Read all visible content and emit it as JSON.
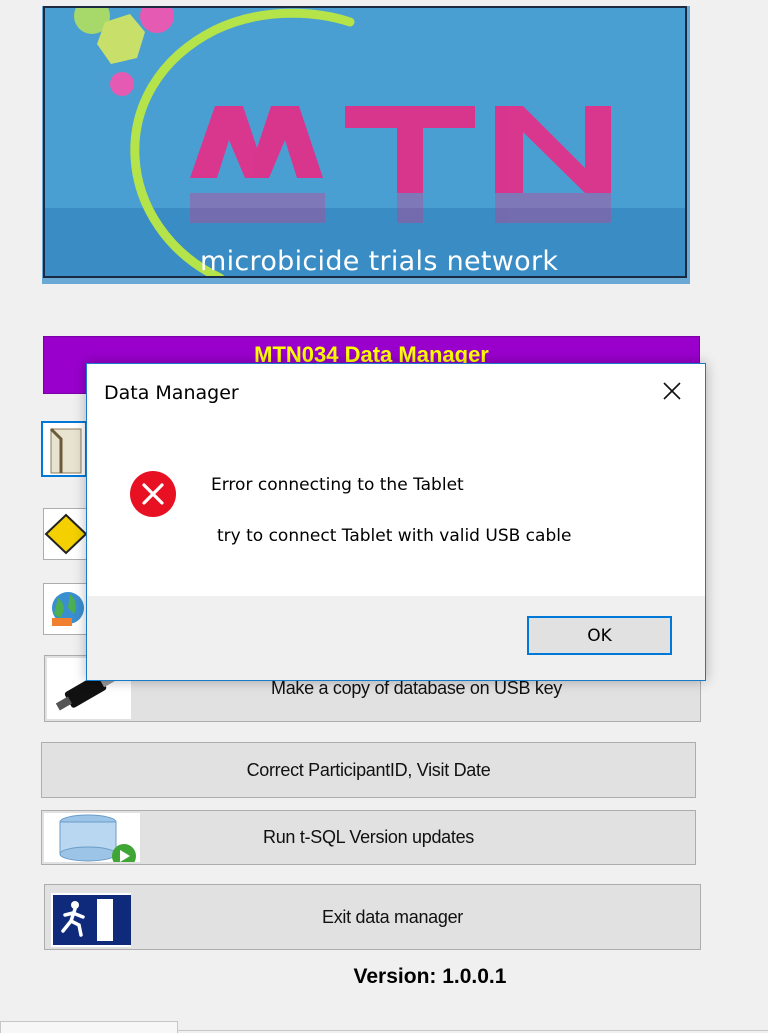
{
  "logo": {
    "letters": "MTN",
    "tagline": "microbicide trials network"
  },
  "panel": {
    "title": "MTN034 Data Manager",
    "buttons": {
      "usb_copy": "Make a copy of database on USB key",
      "correct_ids": "Correct ParticipantID, Visit Date",
      "tsql": "Run t-SQL Version updates",
      "exit": "Exit data manager"
    },
    "version": "Version: 1.0.0.1"
  },
  "dialog": {
    "title": "Data Manager",
    "message_line1": "Error connecting to the Tablet",
    "message_line2": "try to connect Tablet with valid USB cable",
    "ok_label": "OK",
    "icon": "error-icon"
  },
  "colors": {
    "title_bar_bg": "#9900cc",
    "title_bar_text": "#ffff00",
    "logo_bg": "#4a9fd2",
    "logo_letters": "#e0308a",
    "error_red": "#e81123",
    "dialog_accent": "#0078d7"
  }
}
